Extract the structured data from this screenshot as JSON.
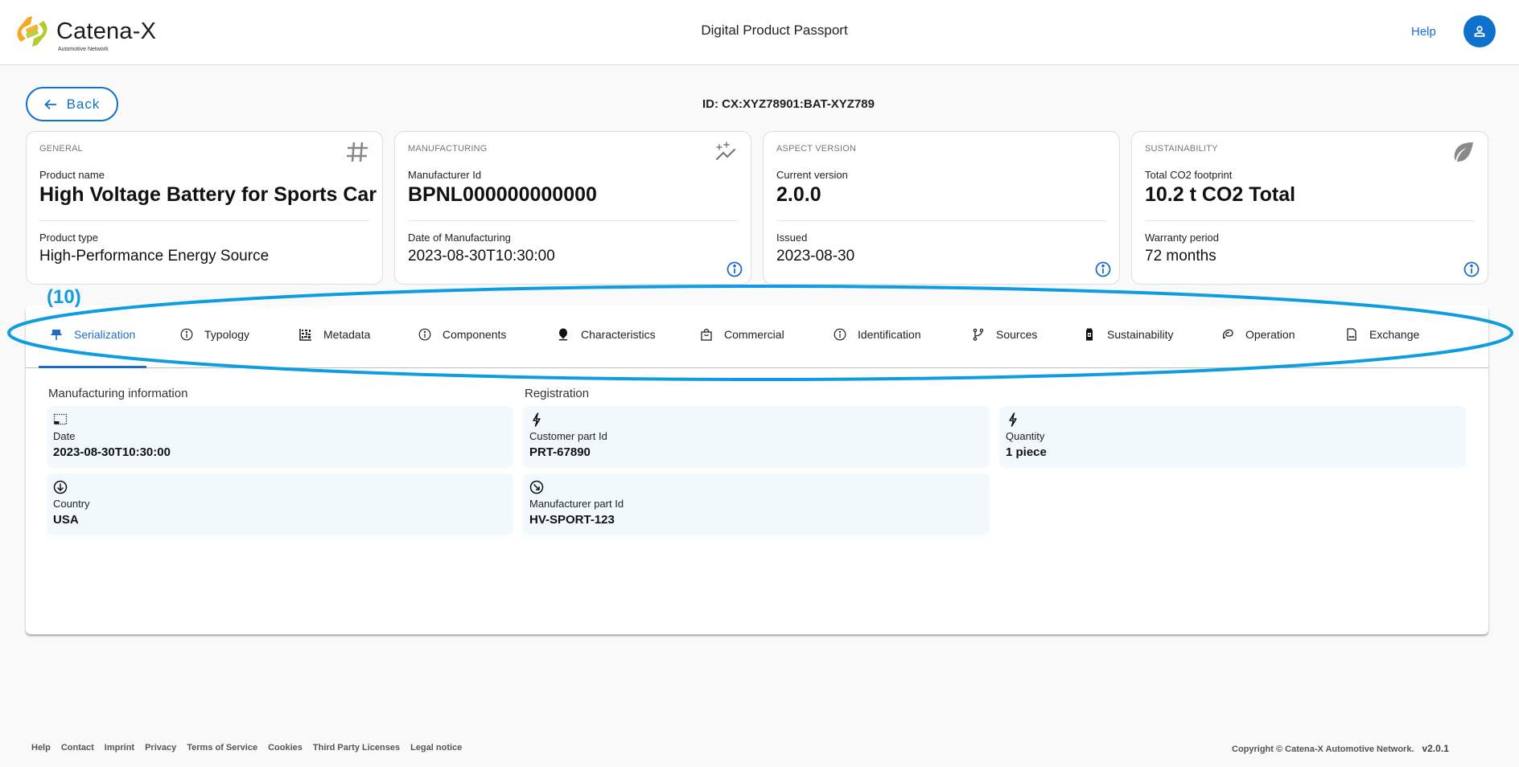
{
  "header": {
    "logo_title": "Catena-X",
    "logo_subtitle": "Automotive Network",
    "app_title": "Digital Product Passport",
    "help_label": "Help",
    "avatar_icon": "user-icon"
  },
  "back_button": {
    "label": "Back",
    "icon": "arrow-left-icon"
  },
  "passport_id": "ID: CX:XYZ78901:BAT-XYZ789",
  "cards": [
    {
      "category": "GENERAL",
      "icon": "hash-icon",
      "label1": "Product name",
      "value1": "High Voltage Battery for Sports Car",
      "label2": "Product type",
      "value2": "High-Performance Energy Source",
      "has_info": false
    },
    {
      "category": "MANUFACTURING",
      "icon": "sparkle-chart-icon",
      "label1": "Manufacturer Id",
      "value1": "BPNL000000000000",
      "label2": "Date of Manufacturing",
      "value2": "2023-08-30T10:30:00",
      "has_info": true
    },
    {
      "category": "ASPECT VERSION",
      "icon": "",
      "label1": "Current version",
      "value1": "2.0.0",
      "label2": "Issued",
      "value2": "2023-08-30",
      "has_info": true
    },
    {
      "category": "SUSTAINABILITY",
      "icon": "leaf-icon",
      "label1": "Total CO2 footprint",
      "value1": "10.2 t CO2 Total",
      "label2": "Warranty period",
      "value2": "72 months",
      "has_info": true
    }
  ],
  "annotation": {
    "label": "(10)",
    "color": "#0f9ddf"
  },
  "tabs": [
    {
      "label": "Serialization",
      "icon": "pin-icon",
      "active": true
    },
    {
      "label": "Typology",
      "icon": "info-icon",
      "active": false
    },
    {
      "label": "Metadata",
      "icon": "datamatrix-icon",
      "active": false
    },
    {
      "label": "Components",
      "icon": "info-icon",
      "active": false
    },
    {
      "label": "Characteristics",
      "icon": "bulb-icon",
      "active": false
    },
    {
      "label": "Commercial",
      "icon": "shopping-bag-icon",
      "active": false
    },
    {
      "label": "Identification",
      "icon": "info-icon",
      "active": false
    },
    {
      "label": "Sources",
      "icon": "branch-icon",
      "active": false
    },
    {
      "label": "Sustainability",
      "icon": "battery-icon",
      "active": false
    },
    {
      "label": "Operation",
      "icon": "cycle-icon",
      "active": false
    },
    {
      "label": "Exchange",
      "icon": "document-exchange-icon",
      "active": false
    }
  ],
  "serialization": {
    "manufacturing_section": "Manufacturing information",
    "registration_section": "Registration",
    "manufacturing_items": [
      {
        "icon": "dotted-frame-icon",
        "label": "Date",
        "value": "2023-08-30T10:30:00"
      },
      {
        "icon": "arrow-down-circle-icon",
        "label": "Country",
        "value": "USA"
      }
    ],
    "registration_items": [
      {
        "icon": "bolt-icon",
        "label": "Customer part Id",
        "value": "PRT-67890"
      },
      {
        "icon": "bolt-icon",
        "label": "Quantity",
        "value": "1 piece"
      },
      {
        "icon": "arrow-down-right-circle-icon",
        "label": "Manufacturer part Id",
        "value": "HV-SPORT-123"
      }
    ]
  },
  "footer": {
    "links": [
      "Help",
      "Contact",
      "Imprint",
      "Privacy",
      "Terms of Service",
      "Cookies",
      "Third Party Licenses",
      "Legal notice"
    ],
    "copyright": "Copyright © Catena-X Automotive Network.",
    "version": "v2.0.1"
  },
  "colors": {
    "primary": "#0f71cb",
    "link": "#1d6cc8",
    "tile_bg": "#f2f9fc",
    "annotation": "#0f9ddf"
  }
}
